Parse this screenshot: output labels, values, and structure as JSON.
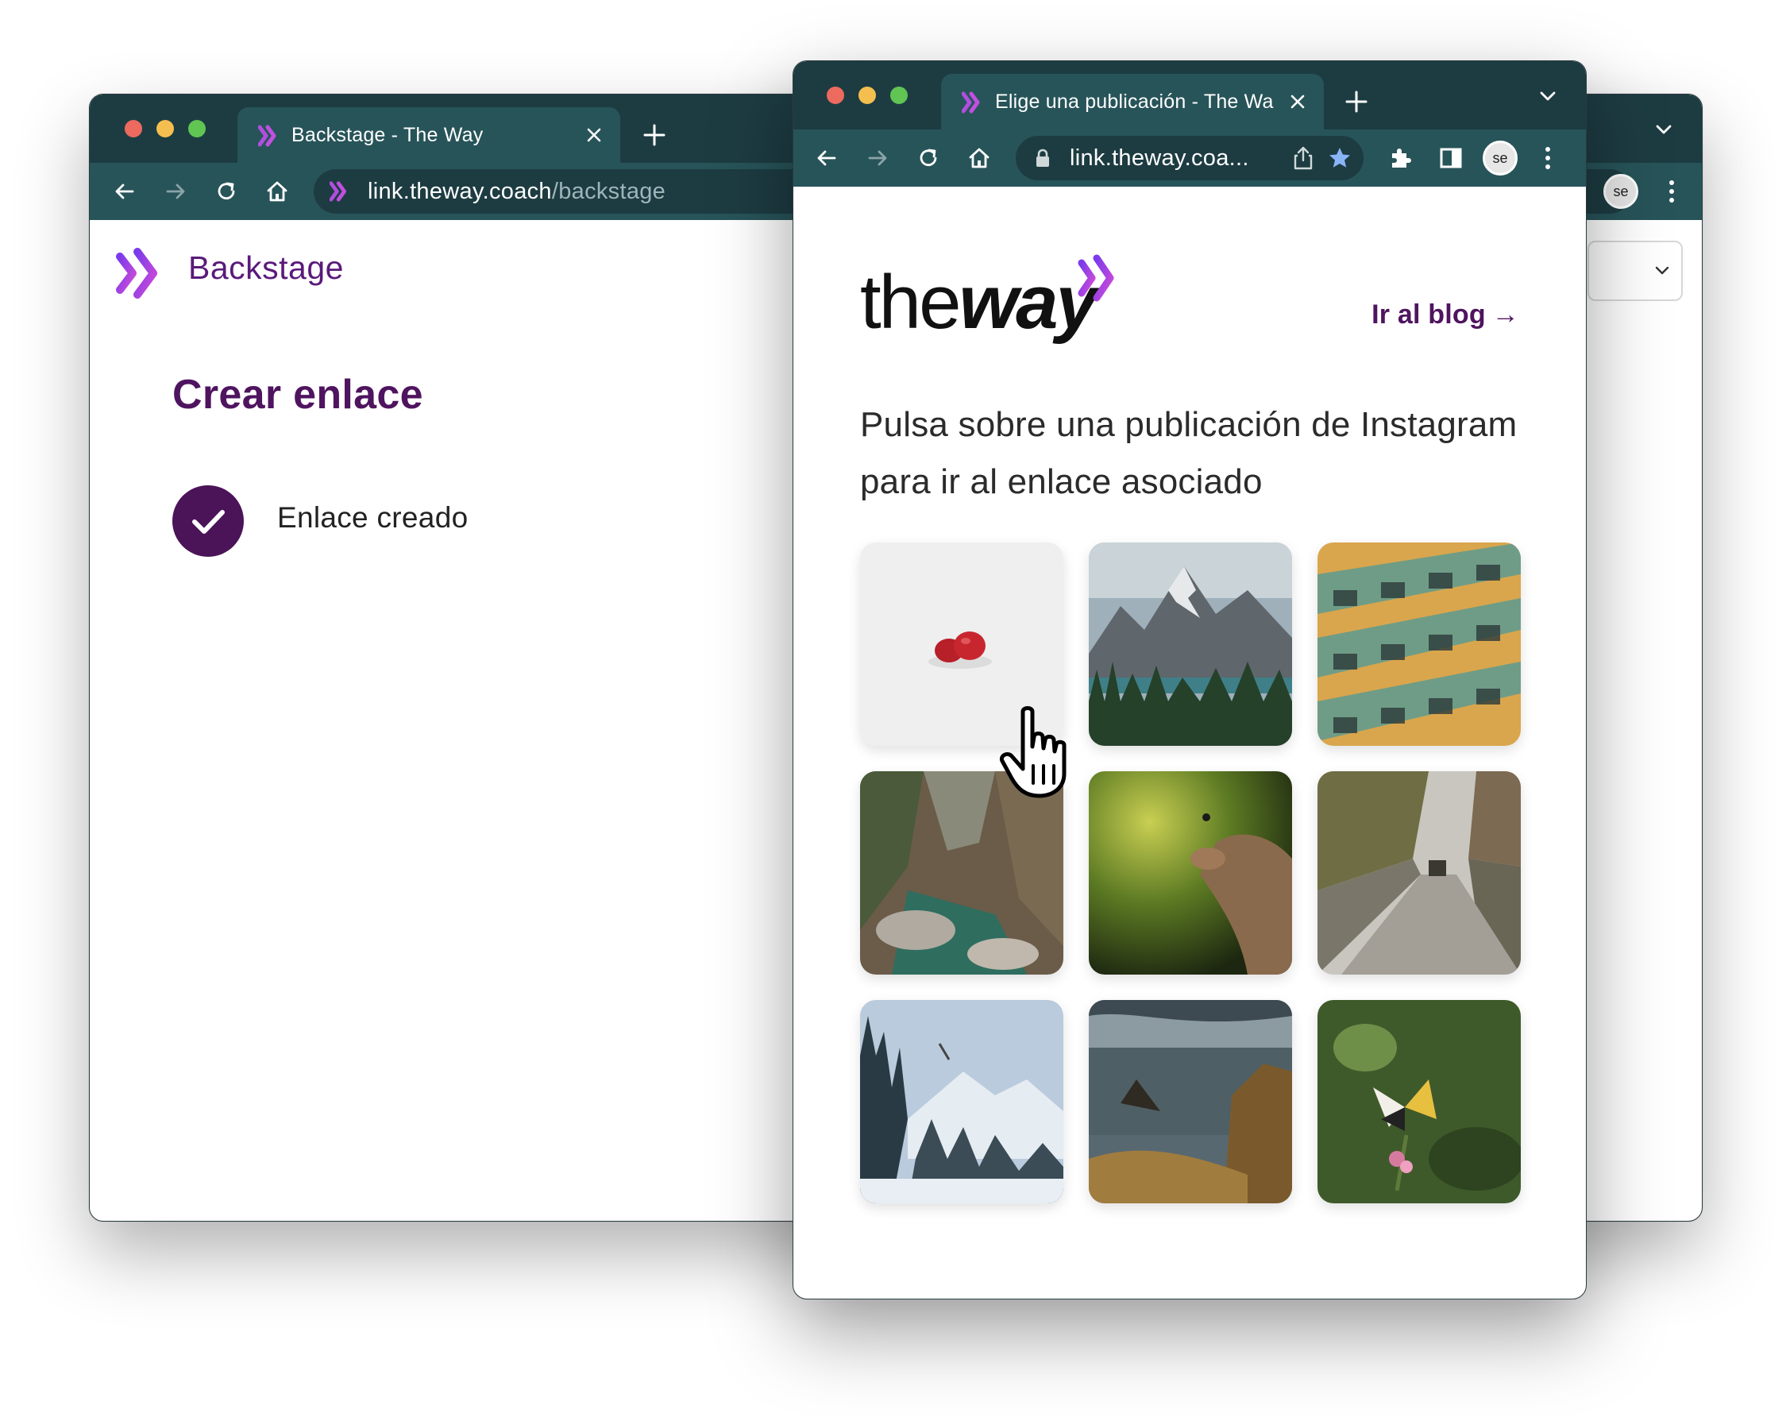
{
  "back_window": {
    "tab_title": "Backstage - The Way",
    "url_host": "link.theway.coach",
    "url_path": "/backstage",
    "brand": "Backstage",
    "heading": "Crear enlace",
    "status_text": "Enlace creado",
    "profile_initials": "se"
  },
  "front_window": {
    "tab_title": "Elige una publicación - The Wa",
    "url": "link.theway.coa...",
    "profile_initials": "se",
    "logo_text_regular": "the",
    "logo_text_bold": "way",
    "blog_link": "Ir al blog",
    "blog_arrow": "→",
    "lead_text": "Pulsa sobre una publicación de Instagram para ir al enlace asociado",
    "posts": [
      {
        "name": "gummies",
        "colors": [
          "#f1f1f1",
          "#c0242c"
        ]
      },
      {
        "name": "mountain-lake",
        "colors": [
          "#7d8790",
          "#2f4a2c"
        ]
      },
      {
        "name": "apartment-building",
        "colors": [
          "#e5b35a",
          "#5f8f7a"
        ]
      },
      {
        "name": "rocky-gorge",
        "colors": [
          "#6d5e49",
          "#2f6a5c"
        ]
      },
      {
        "name": "hand-in-sunlight",
        "colors": [
          "#a0a93d",
          "#2c3716"
        ]
      },
      {
        "name": "stone-wall-path",
        "colors": [
          "#8d8b70",
          "#a7a39a"
        ]
      },
      {
        "name": "snowy-forest",
        "colors": [
          "#b7c8d9",
          "#25333d"
        ]
      },
      {
        "name": "coastal-cliffs",
        "colors": [
          "#5a6a72",
          "#8c6a35"
        ]
      },
      {
        "name": "butterfly",
        "colors": [
          "#4e6e34",
          "#e8c040"
        ]
      }
    ]
  },
  "colors": {
    "tabbar": "#1d3c42",
    "toolbar": "#275459",
    "accent_purple": "#4f145f",
    "logo_gradient": [
      "#7b3bea",
      "#d04bd8"
    ]
  }
}
